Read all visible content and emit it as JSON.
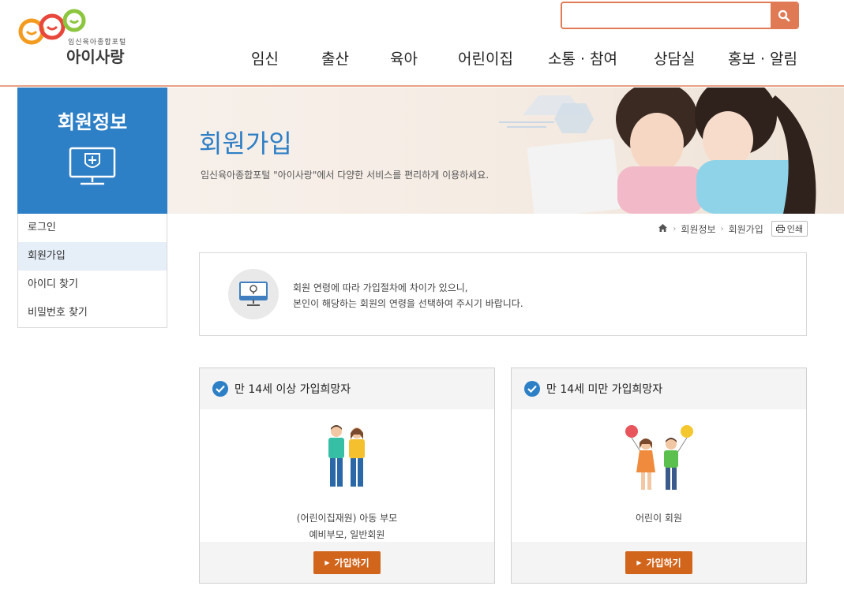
{
  "header": {
    "logo": {
      "sub": "임신육아종합포털",
      "main": "아이사랑"
    },
    "search": {
      "placeholder": "",
      "value": ""
    },
    "nav": [
      "임신",
      "출산",
      "육아",
      "어린이집",
      "소통 · 참여",
      "상담실",
      "홍보 · 알림"
    ]
  },
  "sidebar": {
    "title": "회원정보",
    "items": [
      {
        "label": "로그인"
      },
      {
        "label": "회원가입"
      },
      {
        "label": "아이디 찾기"
      },
      {
        "label": "비밀번호 찾기"
      }
    ]
  },
  "banner": {
    "title": "회원가입",
    "desc": "임신육아종합포털 \"아이사랑\"에서 다양한 서비스를 편리하게 이용하세요."
  },
  "breadcrumb": {
    "items": [
      "회원정보",
      "회원가입"
    ],
    "print_label": "인쇄"
  },
  "notice": {
    "line1": "회원 연령에 따라 가입절차에 차이가 있으니,",
    "line2": "본인이 해당하는 회원의 연령을 선택하여 주시기 바랍니다."
  },
  "cards": [
    {
      "title": "만 14세 이상 가입희망자",
      "desc_line1": "(어린이집재원) 아동 부모",
      "desc_line2": "예비부모, 일반회원",
      "button": "가입하기"
    },
    {
      "title": "만 14세 미만 가입희망자",
      "desc_line1": "어린이 회원",
      "desc_line2": "",
      "button": "가입하기"
    }
  ],
  "colors": {
    "primary_blue": "#2d7fc6",
    "accent_orange": "#e07a54",
    "button_orange": "#d2651c"
  }
}
